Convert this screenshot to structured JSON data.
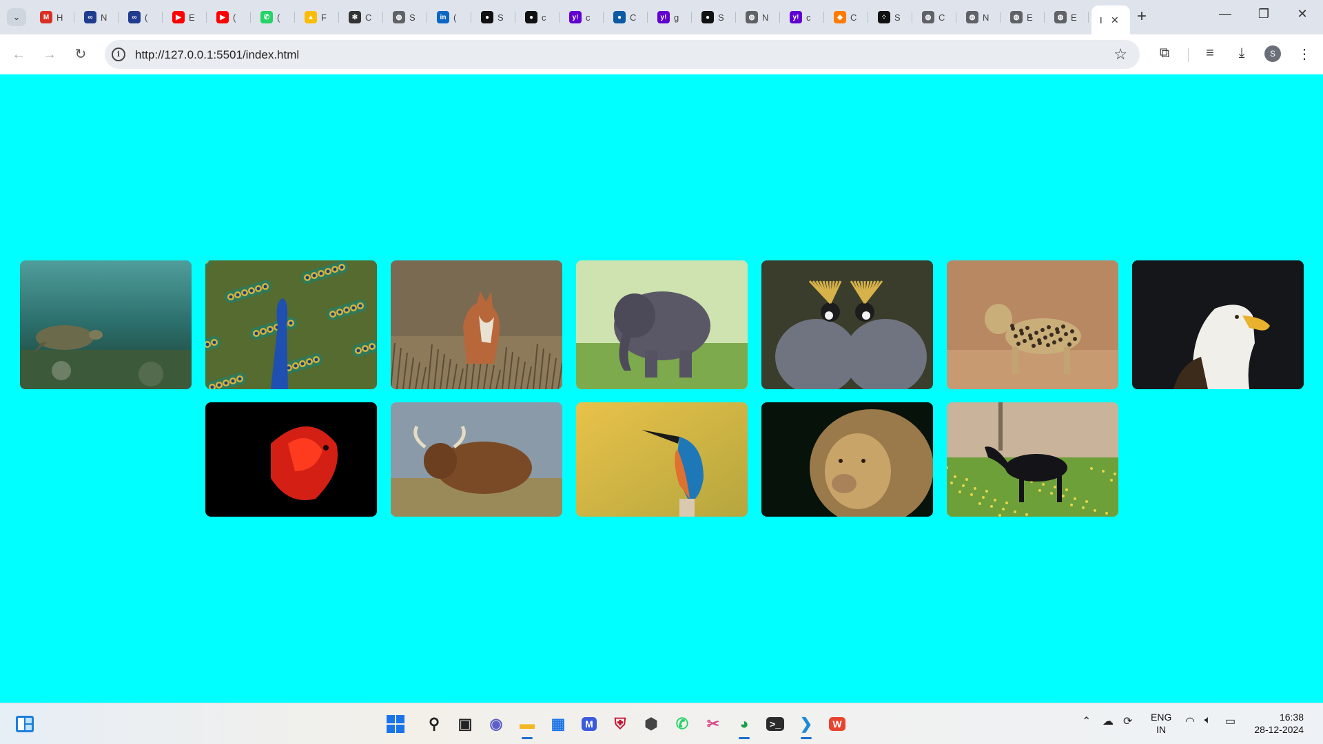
{
  "browser": {
    "tabs": [
      {
        "icon": "gmail-icon",
        "title": "H",
        "color": "#d93025"
      },
      {
        "icon": "meta-icon",
        "title": "N",
        "color": "#1f3c8f"
      },
      {
        "icon": "meta-icon",
        "title": "(",
        "color": "#1f3c8f"
      },
      {
        "icon": "youtube-icon",
        "title": "E",
        "color": "#ff0000"
      },
      {
        "icon": "youtube-icon",
        "title": "(",
        "color": "#ff0000"
      },
      {
        "icon": "whatsapp-icon",
        "title": "(",
        "color": "#25d366"
      },
      {
        "icon": "drive-icon",
        "title": "F",
        "color": "#fbbc04"
      },
      {
        "icon": "chatgpt-icon",
        "title": "C",
        "color": "#333333"
      },
      {
        "icon": "globe-icon",
        "title": "S",
        "color": "#5f6368"
      },
      {
        "icon": "linkedin-icon",
        "title": "(",
        "color": "#0a66c2"
      },
      {
        "icon": "github-icon",
        "title": "S",
        "color": "#111111"
      },
      {
        "icon": "github-icon",
        "title": "c",
        "color": "#111111"
      },
      {
        "icon": "yahoo-icon",
        "title": "c",
        "color": "#6001d2"
      },
      {
        "icon": "edge-icon",
        "title": "C",
        "color": "#0c59a4"
      },
      {
        "icon": "yahoo-icon",
        "title": "g",
        "color": "#6001d2"
      },
      {
        "icon": "github-icon",
        "title": "S",
        "color": "#111111"
      },
      {
        "icon": "globe-icon",
        "title": "N",
        "color": "#5f6368"
      },
      {
        "icon": "yahoo-icon",
        "title": "c",
        "color": "#6001d2"
      },
      {
        "icon": "diamond-icon",
        "title": "C",
        "color": "#ff7a00"
      },
      {
        "icon": "dice-icon",
        "title": "S",
        "color": "#111111"
      },
      {
        "icon": "globe-icon",
        "title": "C",
        "color": "#5f6368"
      },
      {
        "icon": "globe-icon",
        "title": "N",
        "color": "#5f6368"
      },
      {
        "icon": "globe-icon",
        "title": "E",
        "color": "#5f6368"
      },
      {
        "icon": "globe-icon",
        "title": "E",
        "color": "#5f6368"
      }
    ],
    "active_tab": {
      "title": "I",
      "close": "✕"
    },
    "new_tab": "+",
    "window_controls": {
      "minimize": "—",
      "restore": "❐",
      "close": "✕"
    },
    "address": {
      "url": "http://127.0.0.1:5501/index.html",
      "info": "i",
      "bookmark": "☆"
    },
    "nav": {
      "back": "←",
      "forward": "→",
      "reload": "↻"
    },
    "toolbar_icons": {
      "extensions": "⧉",
      "media": "≡",
      "downloads": "⤓",
      "menu": "⋮"
    },
    "profile_initial": "S"
  },
  "page": {
    "background": "#00ffff",
    "gallery": [
      {
        "name": "sea-turtle",
        "subject": "turtle"
      },
      {
        "name": "peacock",
        "subject": "peacock"
      },
      {
        "name": "fox",
        "subject": "fox"
      },
      {
        "name": "elephant",
        "subject": "elephant"
      },
      {
        "name": "crowned-cranes",
        "subject": "cranes"
      },
      {
        "name": "leopard",
        "subject": "leopard"
      },
      {
        "name": "bald-eagle",
        "subject": "eagle"
      },
      {
        "name": "betta-fish",
        "subject": "fish"
      },
      {
        "name": "highland-cow",
        "subject": "cow"
      },
      {
        "name": "kingfisher",
        "subject": "kingfisher"
      },
      {
        "name": "lion",
        "subject": "lion"
      },
      {
        "name": "black-foal",
        "subject": "horse"
      }
    ]
  },
  "taskbar": {
    "apps": [
      {
        "name": "search",
        "icon": "search-icon"
      },
      {
        "name": "task-view",
        "icon": "task-view-icon"
      },
      {
        "name": "teams",
        "icon": "teams-icon"
      },
      {
        "name": "file-explorer",
        "icon": "folder-icon"
      },
      {
        "name": "store",
        "icon": "store-icon"
      },
      {
        "name": "editor",
        "icon": "editor-icon"
      },
      {
        "name": "mcafee",
        "icon": "shield-icon"
      },
      {
        "name": "cube",
        "icon": "cube-icon"
      },
      {
        "name": "whatsapp",
        "icon": "whatsapp-icon"
      },
      {
        "name": "snipping-tool",
        "icon": "scissors-icon"
      },
      {
        "name": "chrome",
        "icon": "chrome-icon"
      },
      {
        "name": "terminal",
        "icon": "terminal-icon"
      },
      {
        "name": "vscode",
        "icon": "vscode-icon"
      },
      {
        "name": "wps",
        "icon": "wps-icon"
      }
    ],
    "language": {
      "line1": "ENG",
      "line2": "IN"
    },
    "time": "16:38",
    "date": "28-12-2024"
  }
}
